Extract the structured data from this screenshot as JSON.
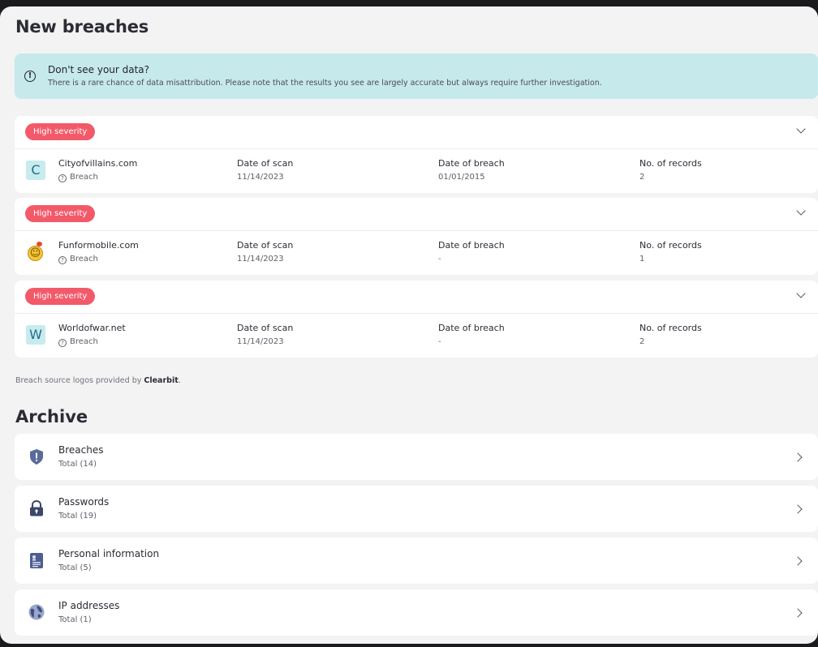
{
  "page": {
    "title": "New breaches"
  },
  "notice": {
    "title": "Don't see your data?",
    "body": "There is a rare chance of data misattribution. Please note that the results you see are largely accurate but always require further investigation.",
    "icon": "info-icon"
  },
  "columns": {
    "scan": "Date of scan",
    "breach": "Date of breach",
    "records": "No. of records"
  },
  "breaches": [
    {
      "severity": "High severity",
      "site": "Cityofvillains.com",
      "type": "Breach",
      "logo_letter": "C",
      "scan_date": "11/14/2023",
      "breach_date": "01/01/2015",
      "records": "2"
    },
    {
      "severity": "High severity",
      "site": "Funformobile.com",
      "type": "Breach",
      "logo_letter": "",
      "scan_date": "11/14/2023",
      "breach_date": "-",
      "records": "1"
    },
    {
      "severity": "High severity",
      "site": "Worldofwar.net",
      "type": "Breach",
      "logo_letter": "W",
      "scan_date": "11/14/2023",
      "breach_date": "-",
      "records": "2"
    }
  ],
  "attribution": {
    "text": "Breach source logos provided by ",
    "brand": "Clearbit",
    "suffix": "."
  },
  "archive": {
    "title": "Archive",
    "items": [
      {
        "label": "Breaches",
        "total": "Total (14)",
        "icon": "shield-alert-icon"
      },
      {
        "label": "Passwords",
        "total": "Total (19)",
        "icon": "lock-icon"
      },
      {
        "label": "Personal information",
        "total": "Total (5)",
        "icon": "id-card-icon"
      },
      {
        "label": "IP addresses",
        "total": "Total (1)",
        "icon": "globe-icon"
      }
    ]
  },
  "colors": {
    "severity_high": "#f25a6a",
    "notice_bg": "#c6e9ec",
    "page_bg": "#f3f3f4"
  }
}
